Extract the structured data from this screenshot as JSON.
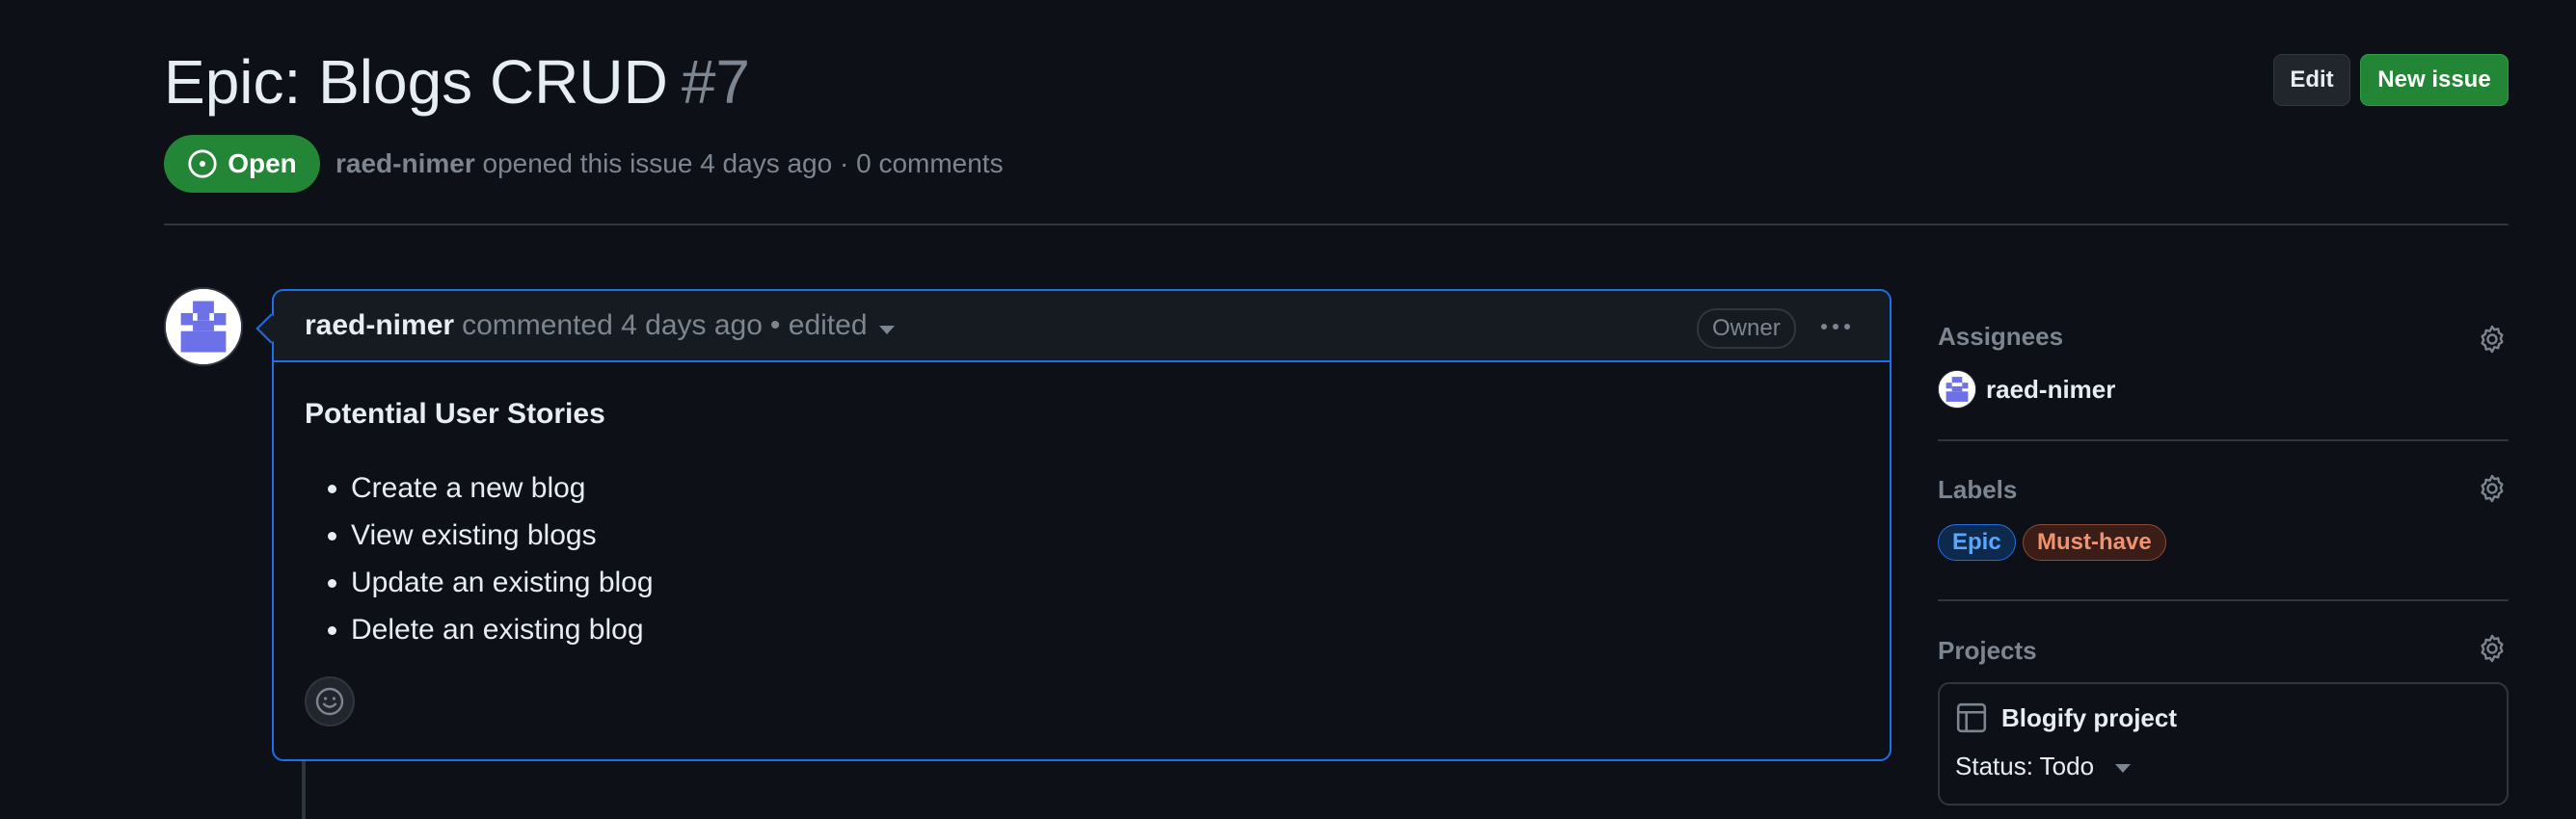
{
  "issue": {
    "title": "Epic: Blogs CRUD",
    "number": "#7",
    "state": "Open",
    "author": "raed-nimer",
    "opened_text": "opened this issue 4 days ago",
    "comments_text": "· 0 comments"
  },
  "toolbar": {
    "edit_label": "Edit",
    "new_issue_label": "New issue"
  },
  "comment": {
    "author": "raed-nimer",
    "action_text": "commented 4 days ago",
    "edited_text": "• edited",
    "role_badge": "Owner",
    "heading": "Potential User Stories",
    "stories": [
      "Create a new blog",
      "View existing blogs",
      "Update an existing blog",
      "Delete an existing blog"
    ]
  },
  "sidebar": {
    "assignees": {
      "label": "Assignees",
      "users": [
        "raed-nimer"
      ]
    },
    "labels": {
      "label": "Labels",
      "items": [
        {
          "name": "Epic",
          "color": "#58a6ff"
        },
        {
          "name": "Must-have",
          "color": "#f0916f"
        }
      ]
    },
    "projects": {
      "label": "Projects",
      "project_name": "Blogify project",
      "status_text": "Status: Todo"
    }
  },
  "colors": {
    "background": "#0d1117",
    "accent_green": "#238636",
    "accent_blue": "#1f6feb",
    "muted_text": "#7d8590"
  },
  "icons": {
    "state": "issue-opened-icon",
    "settings": "gear-icon",
    "project": "table-icon",
    "reaction": "smiley-icon",
    "more": "kebab-horizontal-icon"
  }
}
